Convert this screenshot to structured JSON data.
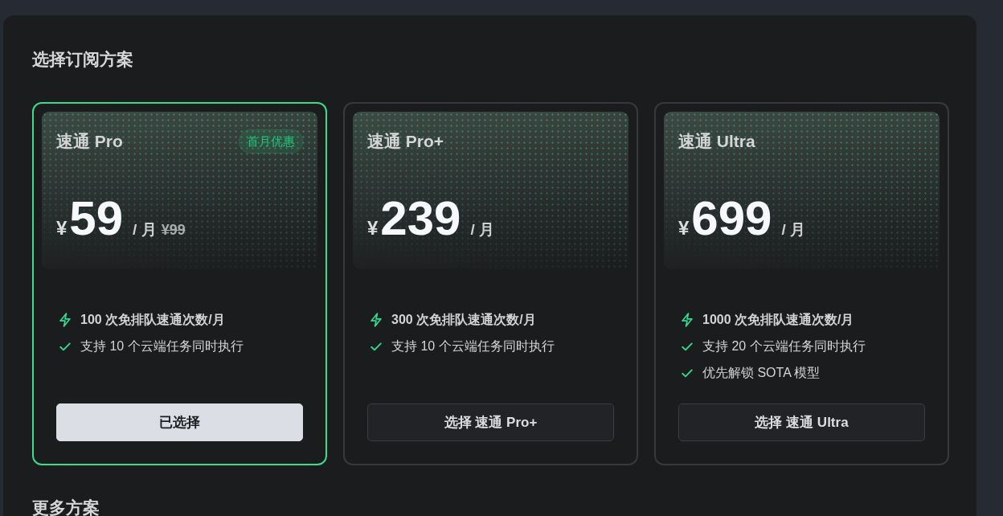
{
  "section_title": "选择订阅方案",
  "plans": [
    {
      "name": "速通 Pro",
      "badge": "首月优惠",
      "currency": "¥",
      "price": "59",
      "period": "/ 月",
      "original_price": "¥99",
      "selected": true,
      "features": [
        {
          "kind": "quota",
          "text": "100 次免排队速通次数/月"
        },
        {
          "kind": "check",
          "text": "支持 10 个云端任务同时执行"
        }
      ],
      "button": "已选择"
    },
    {
      "name": "速通 Pro+",
      "currency": "¥",
      "price": "239",
      "period": "/ 月",
      "selected": false,
      "features": [
        {
          "kind": "quota",
          "text": "300 次免排队速通次数/月"
        },
        {
          "kind": "check",
          "text": "支持 10 个云端任务同时执行"
        }
      ],
      "button": "选择 速通 Pro+"
    },
    {
      "name": "速通 Ultra",
      "currency": "¥",
      "price": "699",
      "period": "/ 月",
      "selected": false,
      "features": [
        {
          "kind": "quota",
          "text": "1000 次免排队速通次数/月"
        },
        {
          "kind": "check",
          "text": "支持 20 个云端任务同时执行"
        },
        {
          "kind": "check",
          "text": "优先解锁 SOTA 模型"
        }
      ],
      "button": "选择 速通 Ultra"
    }
  ],
  "more_title": "更多方案"
}
